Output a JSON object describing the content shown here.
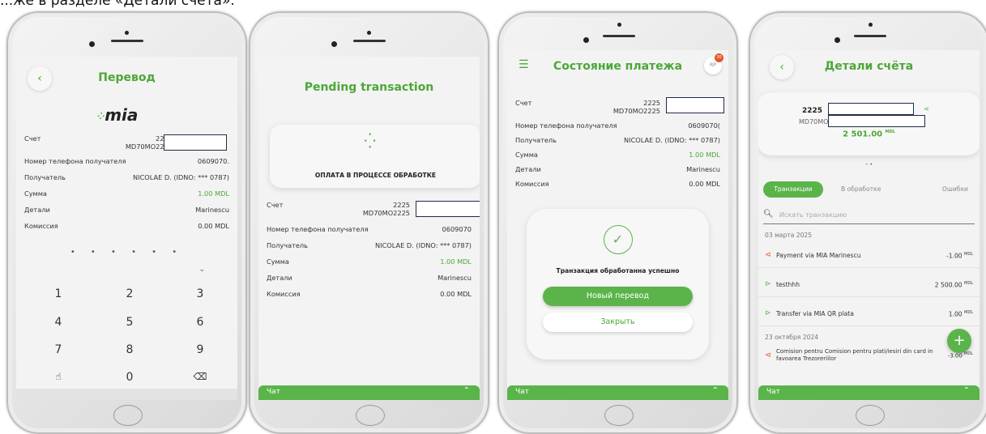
{
  "caption": "...же в разделе «Детали счёта».",
  "colors": {
    "accent": "#4ca737",
    "button": "#5ab44a"
  },
  "phone1": {
    "title": "Перевод",
    "logo": "mia",
    "rows": [
      {
        "k": "Счет",
        "v": "2225"
      },
      {
        "k": "",
        "v": "MD70MO2225"
      },
      {
        "k": "Номер телефона получателя",
        "v": "0609070."
      },
      {
        "k": "Получатель",
        "v": "NICOLAE D. (IDNO: *** 0787)"
      },
      {
        "k": "Сумма",
        "v": "1.00 MDL"
      },
      {
        "k": "Детали",
        "v": "Marinescu"
      },
      {
        "k": "Комиссия",
        "v": "0.00 MDL"
      }
    ],
    "pin_dots": "• • • • • •",
    "keys": [
      "1",
      "2",
      "3",
      "4",
      "5",
      "6",
      "7",
      "8",
      "9",
      "",
      "0",
      ""
    ],
    "fingerprint_icon": "fingerprint-icon",
    "backspace_icon": "backspace-icon"
  },
  "phone2": {
    "title": "Pending transaction",
    "status": "ОПЛАТА В ПРОЦЕССЕ ОБРАБОТКЕ",
    "rows": [
      {
        "k": "Счет",
        "v": "2225"
      },
      {
        "k": "",
        "v": "MD70MO2225"
      },
      {
        "k": "Номер телефона получателя",
        "v": "0609070"
      },
      {
        "k": "Получатель",
        "v": "NICOLAE D. (IDNO: *** 0787)"
      },
      {
        "k": "Сумма",
        "v": "1.00 MDL"
      },
      {
        "k": "Детали",
        "v": "Marinescu"
      },
      {
        "k": "Комиссия",
        "v": "0.00 MDL"
      }
    ],
    "chat": "Чат"
  },
  "phone3": {
    "title": "Состояние платежа",
    "avatar": "RP",
    "badge": "30",
    "rows": [
      {
        "k": "Счет",
        "v": "2225"
      },
      {
        "k": "",
        "v": "MD70MO2225"
      },
      {
        "k": "Номер телефона получателя",
        "v": "0609070("
      },
      {
        "k": "Получатель",
        "v": "NICOLAE D. (IDNO: *** 0787)"
      },
      {
        "k": "Сумма",
        "v": "1.00 MDL"
      },
      {
        "k": "Детали",
        "v": "Marinescu"
      },
      {
        "k": "Комиссия",
        "v": "0.00 MDL"
      }
    ],
    "success": "Транзакция обработанна успешно",
    "new_transfer": "Новый перевод",
    "close": "Закрыть",
    "chat": "Чат"
  },
  "phone4": {
    "title": "Детали счёта",
    "account": "2225",
    "iban": "MD70MO",
    "balance": "2 501.00",
    "balance_currency": "MDL",
    "tabs": [
      "Транзакции",
      "В обработке",
      "Ошибки"
    ],
    "search_placeholder": "Искать транзакцию",
    "date1": "03 марта 2025",
    "transactions": [
      {
        "desc": "Payment via MIA Marinescu",
        "amount": "-1.00",
        "cur": "MDL",
        "dir": "out"
      },
      {
        "desc": "testhhh",
        "amount": "2 500.00",
        "cur": "MDL",
        "dir": "in"
      },
      {
        "desc": "Transfer via MIA QR plata",
        "amount": "1.00",
        "cur": "MDL",
        "dir": "in"
      }
    ],
    "date2": "23 октября 2024",
    "last_tx": {
      "desc": "Comision pentru Comision pentru plati/iesiri din card in favoarea Trezoreriilor",
      "amount": "-3.00",
      "cur": "MDL"
    },
    "fab": "+",
    "chat": "Чат"
  }
}
